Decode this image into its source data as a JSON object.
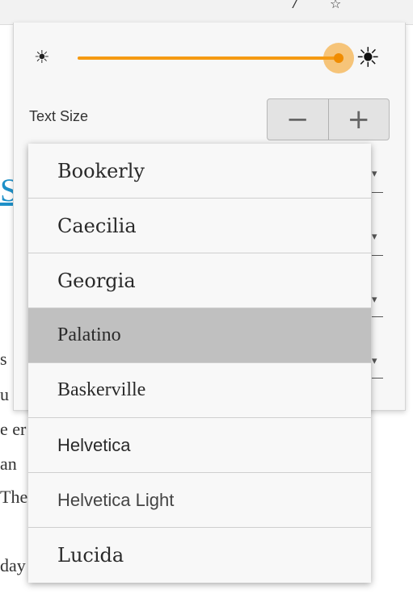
{
  "book": {
    "heading_fragment": "S",
    "lines": [
      "s",
      "u",
      "e er",
      " an",
      "The",
      "",
      "day"
    ]
  },
  "brightness": {
    "low_icon": "sun-dim-icon",
    "high_icon": "sun-bright-icon",
    "level": 1.0,
    "accent_color": "#f59a12"
  },
  "text_size": {
    "label": "Text Size",
    "decrease_label": "−",
    "increase_label": "+"
  },
  "dropdown_arrow": "▾",
  "font_menu": {
    "selected": "Palatino",
    "items": [
      {
        "label": "Bookerly"
      },
      {
        "label": "Caecilia"
      },
      {
        "label": "Georgia"
      },
      {
        "label": "Palatino"
      },
      {
        "label": "Baskerville"
      },
      {
        "label": "Helvetica"
      },
      {
        "label": "Helvetica Light"
      },
      {
        "label": "Lucida"
      }
    ]
  }
}
